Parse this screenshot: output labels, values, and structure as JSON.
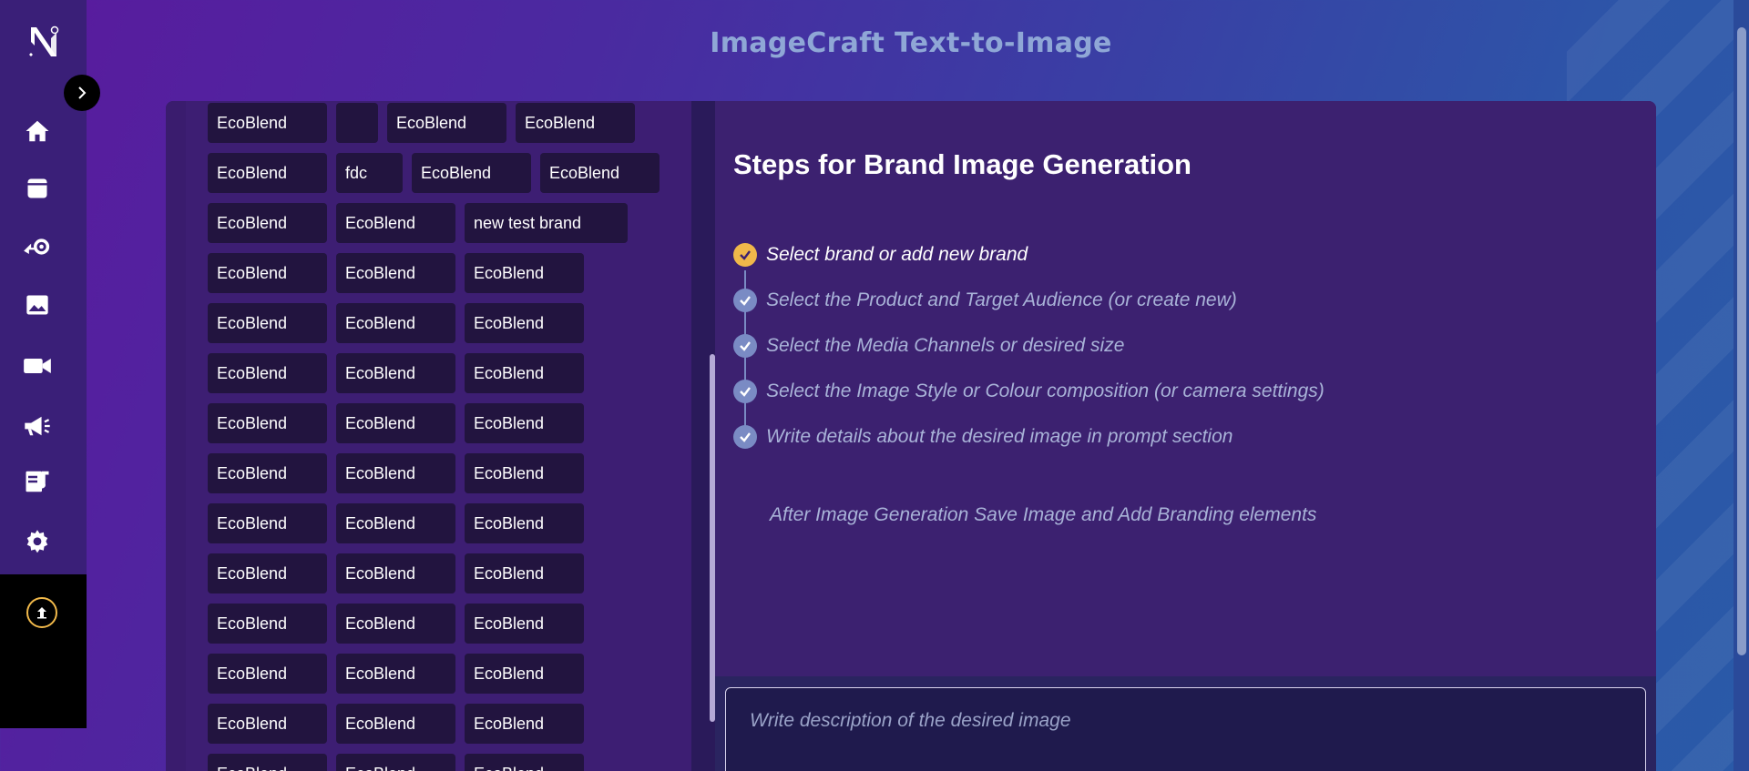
{
  "app": {
    "title": "ImageCraft Text-to-Image"
  },
  "sidebar": {
    "items": [
      {
        "icon": "home-icon"
      },
      {
        "icon": "document-icon"
      },
      {
        "icon": "automation-icon"
      },
      {
        "icon": "image-icon"
      },
      {
        "icon": "video-icon"
      },
      {
        "icon": "megaphone-icon"
      },
      {
        "icon": "edit-content-icon"
      },
      {
        "icon": "gear-icon"
      }
    ],
    "accent": "#f0b84a"
  },
  "brands": {
    "rows": [
      [
        "EcoBlend",
        "",
        "EcoBlend",
        "EcoBlend"
      ],
      [
        "EcoBlend",
        "fdc",
        "EcoBlend",
        "EcoBlend"
      ],
      [
        "EcoBlend",
        "EcoBlend",
        "new test brand"
      ],
      [
        "EcoBlend",
        "EcoBlend",
        "EcoBlend"
      ],
      [
        "EcoBlend",
        "EcoBlend",
        "EcoBlend"
      ],
      [
        "EcoBlend",
        "EcoBlend",
        "EcoBlend"
      ],
      [
        "EcoBlend",
        "EcoBlend",
        "EcoBlend"
      ],
      [
        "EcoBlend",
        "EcoBlend",
        "EcoBlend"
      ],
      [
        "EcoBlend",
        "EcoBlend",
        "EcoBlend"
      ],
      [
        "EcoBlend",
        "EcoBlend",
        "EcoBlend"
      ],
      [
        "EcoBlend",
        "EcoBlend",
        "EcoBlend"
      ],
      [
        "EcoBlend",
        "EcoBlend",
        "EcoBlend"
      ],
      [
        "EcoBlend",
        "EcoBlend",
        "EcoBlend"
      ],
      [
        "EcoBlend",
        "EcoBlend",
        "EcoBlend"
      ]
    ]
  },
  "steps": {
    "heading": "Steps for Brand Image Generation",
    "items": [
      {
        "label": "Select brand or add new brand",
        "active": true
      },
      {
        "label": "Select the Product and Target Audience (or create new)",
        "active": false
      },
      {
        "label": "Select the Media Channels or desired size",
        "active": false
      },
      {
        "label": "Select the Image Style or Colour composition (or camera settings)",
        "active": false
      },
      {
        "label": "Write details about the desired image in prompt section",
        "active": false
      }
    ],
    "note": "After Image Generation Save Image and Add Branding elements",
    "active_color": "#f0b84a",
    "inactive_color": "#7a8bc4"
  },
  "prompt": {
    "placeholder": "Write description of the desired image"
  }
}
